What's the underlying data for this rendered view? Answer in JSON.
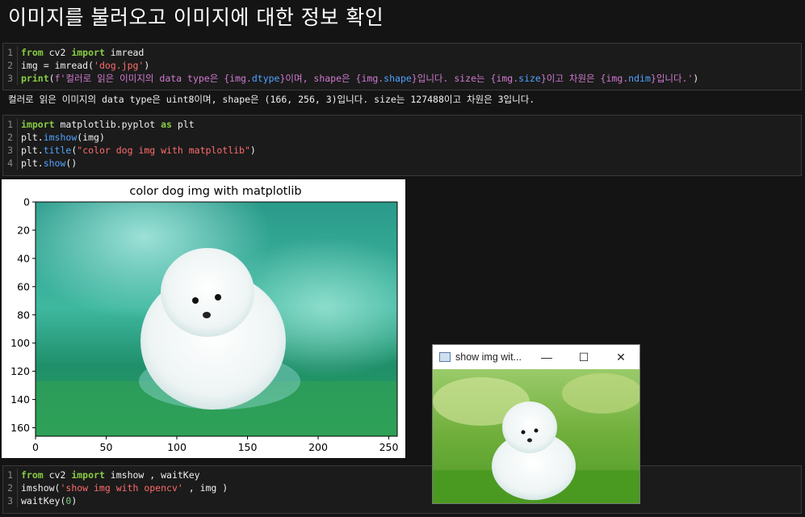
{
  "page": {
    "title": "이미지를 불러오고 이미지에 대한 정보 확인"
  },
  "cell1": {
    "line_numbers": [
      "1",
      "2",
      "3"
    ],
    "l1": {
      "kw1": "from",
      "mod": " cv2 ",
      "kw2": "import",
      "name": " imread"
    },
    "l2": {
      "var": "img ",
      "eq": "=",
      "call": " imread(",
      "str": "'dog.jpg'",
      "close": ")"
    },
    "l3": {
      "print": "print",
      "open": "(",
      "fprefix": "f'컬러로 읽은 이미지의 data type은 ",
      "b1": "{img.",
      "a1": "dtype",
      "e1": "}",
      "t1": "이며, shape은 ",
      "b2": "{img.",
      "a2": "shape",
      "e2": "}",
      "t2": "입니다. size는 ",
      "b3": "{img.",
      "a3": "size",
      "e3": "}",
      "t3": "이고 차원은 ",
      "b4": "{img.",
      "a4": "ndim",
      "e4": "}",
      "t4": "입니다.'",
      "close": ")"
    }
  },
  "output_text": "컬러로 읽은 이미지의 data type은 uint8이며, shape은 (166, 256, 3)입니다. size는 127488이고 차원은 3입니다.",
  "cell2": {
    "line_numbers": [
      "1",
      "2",
      "3",
      "4"
    ],
    "l1": {
      "kw1": "import",
      "mod": " matplotlib.pyplot ",
      "kw2": "as",
      "name": " plt"
    },
    "l2": {
      "obj": "plt.",
      "fn": "imshow",
      "args": "(img)"
    },
    "l3": {
      "obj": "plt.",
      "fn": "title",
      "open": "(",
      "str": "\"color dog img with matplotlib\"",
      "close": ")"
    },
    "l4": {
      "obj": "plt.",
      "fn": "show",
      "args": "()"
    }
  },
  "plot": {
    "title": "color dog img with matplotlib",
    "yticks": [
      "0",
      "20",
      "40",
      "60",
      "80",
      "100",
      "120",
      "140",
      "160"
    ],
    "xticks": [
      "0",
      "50",
      "100",
      "150",
      "200",
      "250"
    ]
  },
  "cell3": {
    "line_numbers": [
      "1",
      "2",
      "3"
    ],
    "l1": {
      "kw1": "from",
      "mod": " cv2 ",
      "kw2": "import",
      "name": " imshow , waitKey"
    },
    "l2": {
      "call": "imshow(",
      "str": "'show img with opencv'",
      "rest": " , img )"
    },
    "l3": {
      "call": "waitKey(",
      "num": "0",
      "close": ")"
    }
  },
  "cv_window": {
    "title": "show img wit...",
    "min": "—",
    "max": "☐",
    "close": "✕"
  },
  "colors": {
    "keyword": "#88cc44",
    "string": "#ff6b6b",
    "function": "#4fa3ff",
    "fstring": "#d07ad0"
  }
}
